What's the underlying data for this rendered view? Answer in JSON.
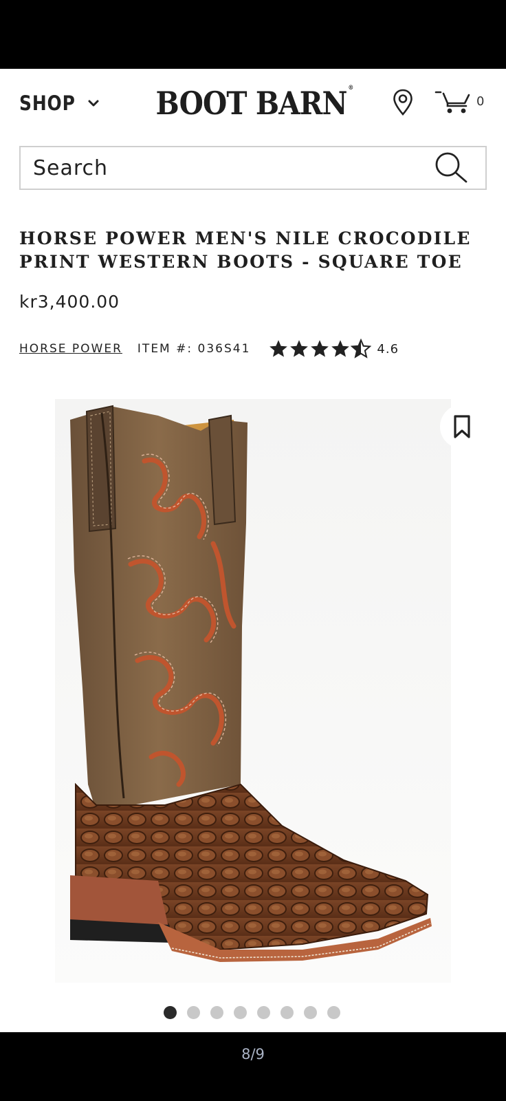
{
  "header": {
    "shop_label": "SHOP",
    "logo_text": "BOOT BARN",
    "logo_mark": "®",
    "cart_count": "0"
  },
  "search": {
    "placeholder": "Search",
    "value": ""
  },
  "product": {
    "title": "HORSE POWER MEN'S NILE CROCODILE PRINT WESTERN BOOTS - SQUARE TOE",
    "price": "kr3,400.00",
    "brand": "HORSE POWER",
    "item_number": "ITEM #: 036S41",
    "rating": "4.6",
    "rating_stars": 4.6
  },
  "gallery": {
    "dot_count": 8,
    "active_dot": 1,
    "pager": "8/9"
  },
  "colors": {
    "accent_dark": "#222222",
    "dot_inactive": "#c8c8c8",
    "boot_shaft": "#7d6144",
    "boot_vamp": "#6b3a1f",
    "stitch": "#c0552e"
  },
  "icons": [
    "chevron-down-icon",
    "location-pin-icon",
    "cart-icon",
    "search-icon",
    "star-icon",
    "bookmark-icon"
  ]
}
